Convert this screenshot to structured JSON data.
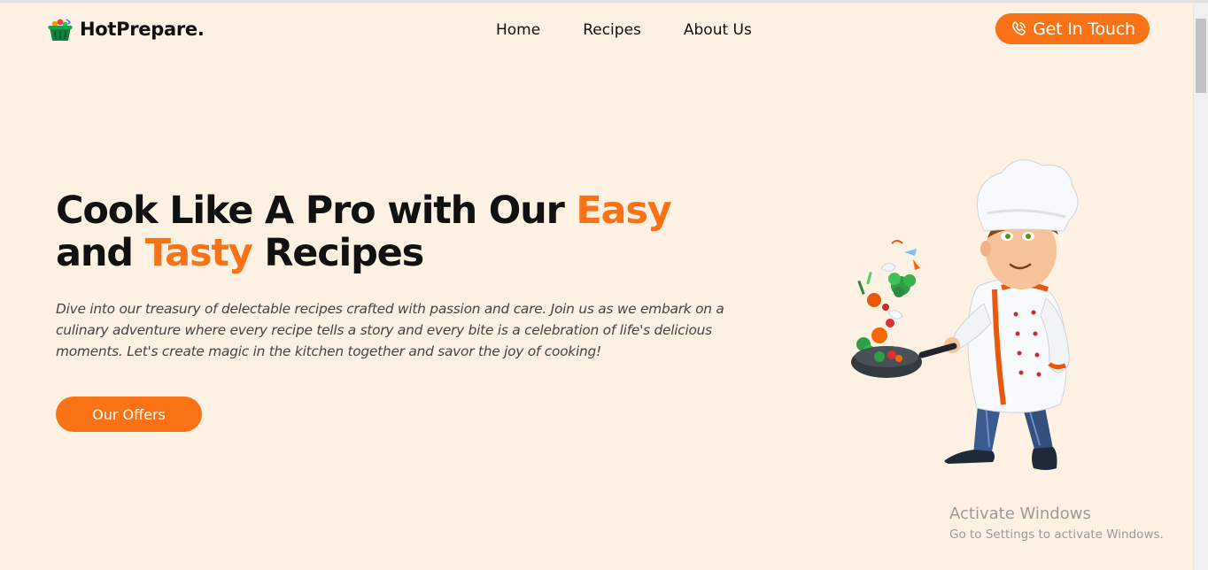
{
  "header": {
    "brand": "HotPrepare.",
    "nav": [
      "Home",
      "Recipes",
      "About Us"
    ],
    "cta_label": "Get In Touch"
  },
  "hero": {
    "title_part1": "Cook Like A Pro with Our ",
    "title_accent1": "Easy",
    "title_part2": "and ",
    "title_accent2": "Tasty",
    "title_part3": " Recipes",
    "description": "Dive into our treasury of delectable recipes crafted with passion and care. Join us as we embark on a culinary adventure where every recipe tells a story and every bite is a celebration of life's delicious moments. Let's create magic in the kitchen together and savor the joy of cooking!",
    "button_label": "Our Offers"
  },
  "watermark": {
    "line1": "Activate Windows",
    "line2": "Go to Settings to activate Windows."
  },
  "colors": {
    "accent": "#f97316",
    "background": "#fdf1e4",
    "text": "#111111"
  },
  "icons": {
    "logo": "basket-icon",
    "cta": "phone-icon",
    "hero_image": "chef-illustration"
  }
}
